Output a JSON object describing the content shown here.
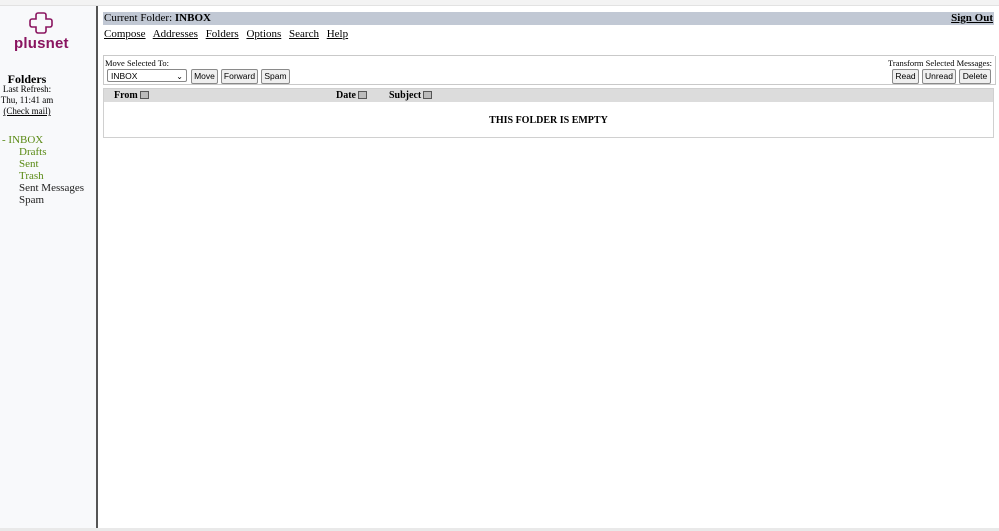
{
  "brand": {
    "name": "plusnet",
    "color": "#8a1560"
  },
  "sidebar": {
    "title": "Folders",
    "last_refresh_label": "Last Refresh:",
    "last_refresh_time": "Thu, 11:41 am",
    "check_mail": "(Check mail)",
    "folders": [
      {
        "prefix": "- ",
        "label": "INBOX",
        "color": "#5a8a14"
      },
      {
        "label": "Drafts",
        "color": "#5a8a14"
      },
      {
        "label": "Sent",
        "color": "#5a8a14"
      },
      {
        "label": "Trash",
        "color": "#5a8a14"
      },
      {
        "label": "Sent Messages",
        "color": "#222222"
      },
      {
        "label": "Spam",
        "color": "#222222"
      }
    ]
  },
  "header": {
    "current_folder_label": "Current Folder:",
    "current_folder": "INBOX",
    "sign_out": "Sign Out"
  },
  "menu": {
    "items": [
      "Compose",
      "Addresses",
      "Folders",
      "Options",
      "Search",
      "Help"
    ]
  },
  "actions": {
    "move_label": "Move Selected To:",
    "move_select_value": "INBOX",
    "move": "Move",
    "forward": "Forward",
    "spam": "Spam",
    "transform_label": "Transform Selected Messages:",
    "read": "Read",
    "unread": "Unread",
    "delete": "Delete"
  },
  "table": {
    "columns": {
      "from": "From",
      "date": "Date",
      "subject": "Subject"
    },
    "empty_message": "THIS FOLDER IS EMPTY"
  },
  "colors": {
    "header_bar": "#c1c8d4",
    "folder_green": "#5a8a14"
  },
  "icons": {
    "logo": "plusnet-cross-icon",
    "sort": "sort-icon",
    "dropdown": "chevron-down-icon"
  }
}
